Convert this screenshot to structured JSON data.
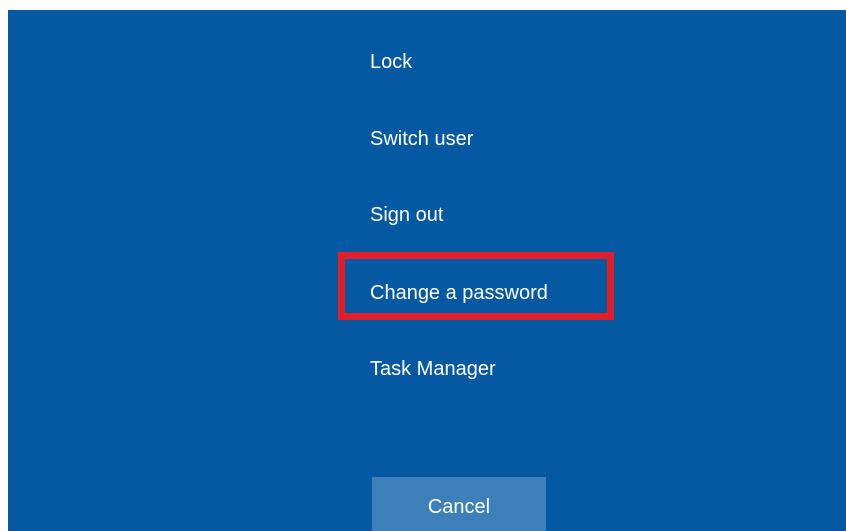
{
  "menu": {
    "items": [
      {
        "label": "Lock"
      },
      {
        "label": "Switch user"
      },
      {
        "label": "Sign out"
      },
      {
        "label": "Change a password",
        "highlighted": true
      },
      {
        "label": "Task Manager"
      }
    ]
  },
  "cancel_label": "Cancel",
  "colors": {
    "background": "#0559a3",
    "highlight_border": "#e01f2b",
    "button": "#3c7fb9",
    "text": "#ffffff"
  }
}
